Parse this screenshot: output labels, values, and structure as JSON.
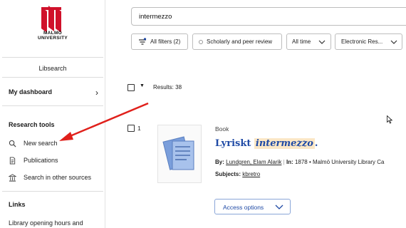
{
  "university": {
    "line1": "MALMÖ",
    "line2": "UNIVERSITY"
  },
  "sidebar": {
    "app_link": "Libsearch",
    "dashboard": "My dashboard",
    "research_tools_title": "Research tools",
    "tools": [
      {
        "label": "New search",
        "icon": "search-icon"
      },
      {
        "label": "Publications",
        "icon": "document-icon"
      },
      {
        "label": "Search in other sources",
        "icon": "library-icon"
      }
    ],
    "links_title": "Links",
    "links": [
      {
        "label": "Library opening hours and"
      }
    ]
  },
  "search": {
    "value": "intermezzo"
  },
  "filters": {
    "all_filters": "All filters (2)",
    "scholarly": "Scholarly and peer review",
    "all_time": "All time",
    "electronic": "Electronic Res..."
  },
  "results": {
    "count_label": "Results: 38"
  },
  "record": {
    "number": "1",
    "type": "Book",
    "title_plain": "Lyriskt ",
    "title_highlight": "intermezzo",
    "title_end": ".",
    "by_label": "By:",
    "author": "Lundgren, Elam Alarik",
    "in_label": "In:",
    "year": "1878",
    "holding": "Malmö University Library Ca",
    "subjects_label": "Subjects:",
    "subject": "kbretro",
    "access_label": "Access options"
  },
  "colors": {
    "brand_red": "#d0112b",
    "link_blue": "#1f4aa5",
    "highlight": "#fbe7c6",
    "arrow_red": "#e0201b"
  }
}
